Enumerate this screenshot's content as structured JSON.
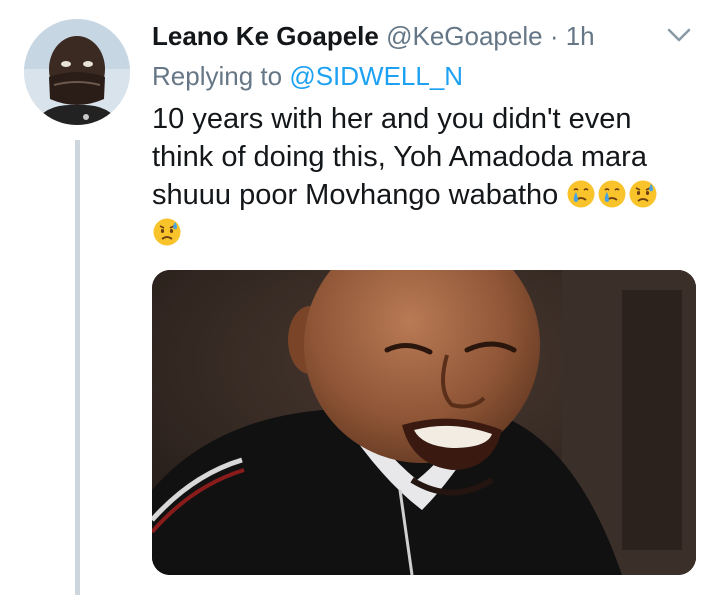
{
  "tweet": {
    "display_name": "Leano Ke Goapele",
    "handle": "@KeGoapele",
    "separator": "·",
    "time": "1h",
    "replying_prefix": "Replying to",
    "reply_target": "@SIDWELL_N",
    "text_lines": [
      "10 years with her and you didn't even",
      "think of doing this, Yoh Amadoda mara",
      "shuuu poor Movhango wabatho"
    ],
    "emojis": [
      "crying-face",
      "crying-face",
      "worried-face-with-sweat",
      "worried-face-with-sweat"
    ],
    "media": {
      "type": "photo",
      "description_icon": "man-crying-photo"
    }
  },
  "icons": {
    "menu_caret": "chevron-down-icon",
    "avatar": "avatar"
  },
  "colors": {
    "text_primary": "#14171a",
    "text_secondary": "#657786",
    "link": "#1da1f2",
    "thread_line": "#cdd6dd"
  }
}
